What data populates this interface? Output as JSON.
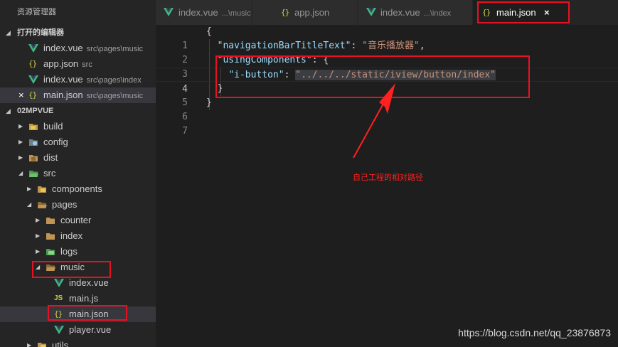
{
  "explorer": {
    "title": "资源管理器",
    "open_editors": {
      "header": "打开的编辑器",
      "items": [
        {
          "label": "index.vue",
          "desc": "src\\pages\\music",
          "icon": "vue-icon"
        },
        {
          "label": "app.json",
          "desc": "src",
          "icon": "json-icon"
        },
        {
          "label": "index.vue",
          "desc": "src\\pages\\index",
          "icon": "vue-icon"
        },
        {
          "label": "main.json",
          "desc": "src\\pages\\music",
          "icon": "json-icon",
          "close": "×"
        }
      ]
    },
    "project": {
      "header": "02MPVUE",
      "tree": [
        {
          "label": "build"
        },
        {
          "label": "config"
        },
        {
          "label": "dist"
        },
        {
          "label": "src"
        },
        {
          "label": "components"
        },
        {
          "label": "pages"
        },
        {
          "label": "counter"
        },
        {
          "label": "index"
        },
        {
          "label": "logs"
        },
        {
          "label": "music"
        },
        {
          "label": "index.vue"
        },
        {
          "label": "main.js",
          "icon_text": "JS"
        },
        {
          "label": "main.json",
          "icon_text": "{}"
        },
        {
          "label": "player.vue"
        },
        {
          "label": "utils"
        }
      ]
    }
  },
  "tabs": [
    {
      "label": "index.vue",
      "desc": "...\\music",
      "icon": "vue-icon"
    },
    {
      "label": "app.json",
      "desc": "",
      "icon": "json-icon"
    },
    {
      "label": "index.vue",
      "desc": "...\\index",
      "icon": "vue-icon"
    },
    {
      "label": "main.json",
      "desc": "",
      "icon": "json-icon",
      "close": "×",
      "active": true
    }
  ],
  "editor": {
    "line_numbers": [
      "1",
      "2",
      "3",
      "4",
      "5",
      "6",
      "7"
    ],
    "lines": [
      {
        "parts": [
          "{"
        ]
      },
      {
        "parts": [
          "\"navigationBarTitleText\"",
          ": ",
          "\"音乐播放器\"",
          ","
        ]
      },
      {
        "parts": [
          "\"usingComponents\"",
          ": {"
        ]
      },
      {
        "parts": [
          "\"i-button\"",
          ": ",
          "\"../../../static/iview/button/index\""
        ]
      },
      {
        "parts": [
          "}"
        ]
      },
      {
        "parts": [
          "}"
        ]
      },
      {
        "parts": [
          ""
        ]
      }
    ],
    "json_icon": "{}"
  },
  "annotation": "自己工程的相对路径",
  "watermark": "https://blog.csdn.net/qq_23876873",
  "colors": {
    "highlight": "#e81123",
    "vue_green": "#41b883",
    "folder_brown": "#c09553",
    "json_yellow": "#cbcb41"
  }
}
